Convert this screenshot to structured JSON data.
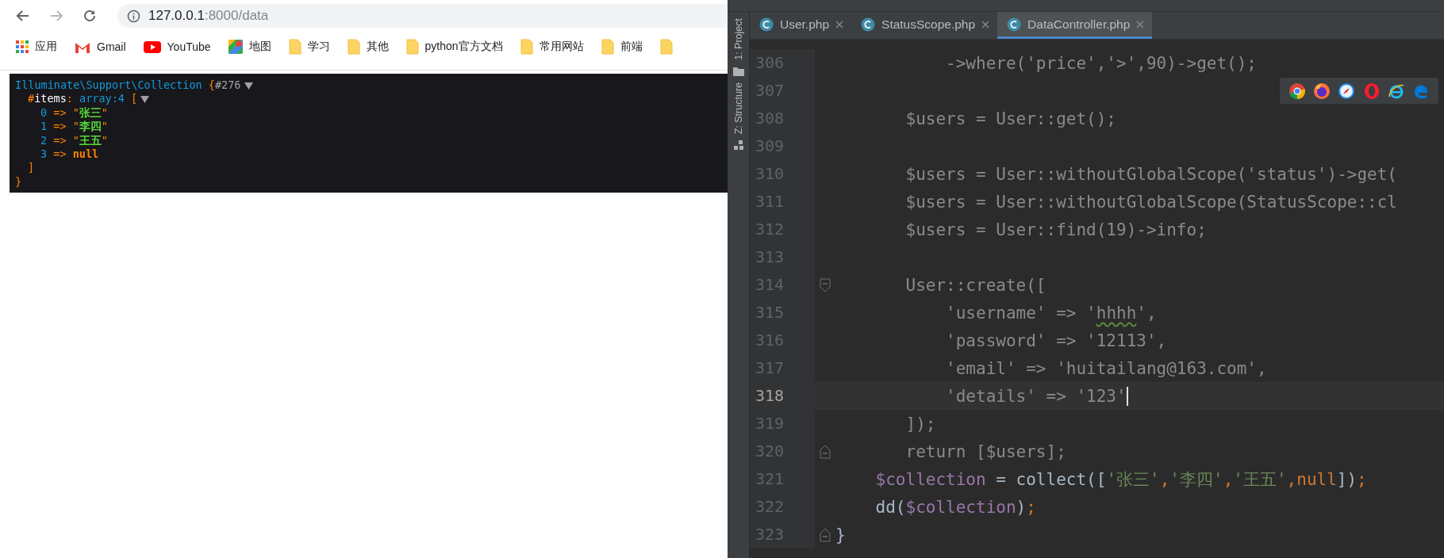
{
  "browser": {
    "nav_buttons": [
      {
        "kind": "back",
        "disabled": false
      },
      {
        "kind": "forward",
        "disabled": true
      },
      {
        "kind": "reload",
        "disabled": false
      }
    ],
    "address": {
      "host": "127.0.0.1",
      "path": ":8000/data"
    },
    "bookmarks": [
      {
        "kind": "apps",
        "label": "应用"
      },
      {
        "kind": "gmail",
        "label": "Gmail"
      },
      {
        "kind": "youtube",
        "label": "YouTube"
      },
      {
        "kind": "maps",
        "label": "地图"
      },
      {
        "kind": "folder",
        "label": "学习"
      },
      {
        "kind": "folder",
        "label": "其他"
      },
      {
        "kind": "folder",
        "label": "python官方文档"
      },
      {
        "kind": "folder",
        "label": "常用网站"
      },
      {
        "kind": "folder",
        "label": "前端"
      },
      {
        "kind": "folder"
      }
    ],
    "dump": {
      "class": "Illuminate\\Support\\Collection",
      "open": "{",
      "id": "#276",
      "expanded": true,
      "property": {
        "sigil": "#",
        "name": "items",
        "separator": ":",
        "type": "array:4",
        "open": "[",
        "expanded": true,
        "close": "]"
      },
      "items": [
        {
          "index": "0",
          "arrow": "=>",
          "kind": "string",
          "value": "\"张三\""
        },
        {
          "index": "1",
          "arrow": "=>",
          "kind": "string",
          "value": "\"李四\""
        },
        {
          "index": "2",
          "arrow": "=>",
          "kind": "string",
          "value": "\"王五\""
        },
        {
          "index": "3",
          "arrow": "=>",
          "kind": "null",
          "value": "null"
        }
      ],
      "close": "}"
    }
  },
  "ide": {
    "tool_windows": [
      {
        "kind": "project",
        "label": "1: Project"
      },
      {
        "kind": "structure",
        "label": "Z: Structure"
      }
    ],
    "tabs": [
      {
        "label": "User.php",
        "selected": false
      },
      {
        "label": "StatusScope.php",
        "selected": false
      },
      {
        "label": "DataController.php",
        "selected": true
      }
    ],
    "browser_icons": [
      {
        "kind": "chrome"
      },
      {
        "kind": "firefox"
      },
      {
        "kind": "safari"
      },
      {
        "kind": "opera"
      },
      {
        "kind": "ie"
      },
      {
        "kind": "edge"
      }
    ],
    "lines": [
      {
        "number": "306",
        "current": false,
        "tokens": [
          {
            "text": "           ->where('price','>',90)->get();",
            "kind": "dim"
          }
        ]
      },
      {
        "number": "307",
        "current": false
      },
      {
        "number": "308",
        "current": false,
        "tokens": [
          {
            "text": "       $users = User::get();",
            "kind": "dim"
          }
        ]
      },
      {
        "number": "309",
        "current": false
      },
      {
        "number": "310",
        "current": false,
        "tokens": [
          {
            "text": "       $users = User::withoutGlobalScope('status')->get(",
            "kind": "dim"
          }
        ]
      },
      {
        "number": "311",
        "current": false,
        "tokens": [
          {
            "text": "       $users = User::withoutGlobalScope(StatusScope::cl",
            "kind": "dim"
          }
        ]
      },
      {
        "number": "312",
        "current": false,
        "tokens": [
          {
            "text": "       $users = User::find(19)->info;",
            "kind": "dim"
          }
        ]
      },
      {
        "number": "313",
        "current": false
      },
      {
        "number": "314",
        "current": false,
        "fold": {
          "kind": "start"
        },
        "tokens": [
          {
            "text": "       User::create([",
            "kind": "dim"
          }
        ]
      },
      {
        "number": "315",
        "current": false,
        "tokens": [
          {
            "text": "           'username' => '",
            "kind": "dim"
          },
          {
            "text": "hhhh",
            "kind": "typo"
          },
          {
            "text": "',",
            "kind": "dim"
          }
        ]
      },
      {
        "number": "316",
        "current": false,
        "tokens": [
          {
            "text": "           'password' => '12113',",
            "kind": "dim"
          }
        ]
      },
      {
        "number": "317",
        "current": false,
        "tokens": [
          {
            "text": "           'email' => 'huitailang@163.com',",
            "kind": "dim"
          }
        ]
      },
      {
        "number": "318",
        "current": true,
        "tokens": [
          {
            "text": "           'details' => '123'",
            "kind": "dim"
          }
        ]
      },
      {
        "number": "319",
        "current": false,
        "tokens": [
          {
            "text": "       ]);",
            "kind": "dim"
          }
        ]
      },
      {
        "number": "320",
        "current": false,
        "fold": {
          "kind": "end"
        },
        "tokens": [
          {
            "text": "       return [$users];",
            "kind": "dim"
          }
        ]
      },
      {
        "number": "321",
        "current": false,
        "tokens": [
          {
            "text": "    $collection",
            "kind": "var"
          },
          {
            "text": " = collect([",
            "kind": "plain"
          },
          {
            "text": "'张三'",
            "kind": "string"
          },
          {
            "text": ",",
            "kind": "punct"
          },
          {
            "text": "'李四'",
            "kind": "string"
          },
          {
            "text": ",",
            "kind": "punct"
          },
          {
            "text": "'王五'",
            "kind": "string"
          },
          {
            "text": ",",
            "kind": "punct"
          },
          {
            "text": "null",
            "kind": "keyword"
          },
          {
            "text": "])",
            "kind": "plain"
          },
          {
            "text": ";",
            "kind": "punct"
          }
        ]
      },
      {
        "number": "322",
        "current": false,
        "tokens": [
          {
            "text": "    dd(",
            "kind": "plain"
          },
          {
            "text": "$collection",
            "kind": "var"
          },
          {
            "text": ")",
            "kind": "plain"
          },
          {
            "text": ";",
            "kind": "punct"
          }
        ]
      },
      {
        "number": "323",
        "current": false,
        "fold": {
          "kind": "end"
        },
        "tokens": [
          {
            "text": "}",
            "kind": "plain"
          }
        ]
      }
    ]
  }
}
